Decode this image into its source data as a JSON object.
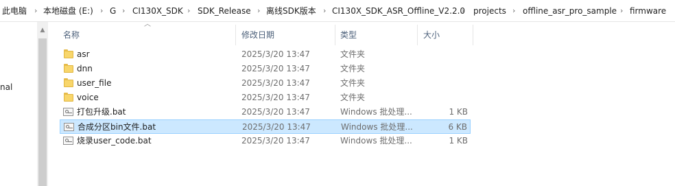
{
  "breadcrumb": [
    {
      "label": "此电脑"
    },
    {
      "label": "本地磁盘 (E:)"
    },
    {
      "label": "G"
    },
    {
      "label": "CI130X_SDK"
    },
    {
      "label": "SDK_Release"
    },
    {
      "label": "离线SDK版本"
    },
    {
      "label": "CI130X_SDK_ASR_Offline_V2.2.0"
    },
    {
      "label": "projects"
    },
    {
      "label": "offline_asr_pro_sample"
    },
    {
      "label": "firmware"
    }
  ],
  "breadcrumb_separator": "›",
  "nav": {
    "partial_label": "nal"
  },
  "columns": {
    "name": "名称",
    "date": "修改日期",
    "type": "类型",
    "size": "大小"
  },
  "files": [
    {
      "name": "asr",
      "date": "2025/3/20 13:47",
      "type": "文件夹",
      "size": "",
      "kind": "folder"
    },
    {
      "name": "dnn",
      "date": "2025/3/20 13:47",
      "type": "文件夹",
      "size": "",
      "kind": "folder"
    },
    {
      "name": "user_file",
      "date": "2025/3/20 13:47",
      "type": "文件夹",
      "size": "",
      "kind": "folder"
    },
    {
      "name": "voice",
      "date": "2025/3/20 13:47",
      "type": "文件夹",
      "size": "",
      "kind": "folder"
    },
    {
      "name": "打包升级.bat",
      "date": "2025/3/20 13:47",
      "type": "Windows 批处理...",
      "size": "1 KB",
      "kind": "bat"
    },
    {
      "name": "合成分区bin文件.bat",
      "date": "2025/3/20 13:47",
      "type": "Windows 批处理...",
      "size": "6 KB",
      "kind": "bat",
      "selected": true
    },
    {
      "name": "烧录user_code.bat",
      "date": "2025/3/20 13:47",
      "type": "Windows 批处理...",
      "size": "1 KB",
      "kind": "bat"
    }
  ],
  "colors": {
    "selection_bg": "#cce8ff",
    "selection_border": "#99d1ff",
    "header_text": "#4c607a",
    "folder": "#f8d66b"
  }
}
